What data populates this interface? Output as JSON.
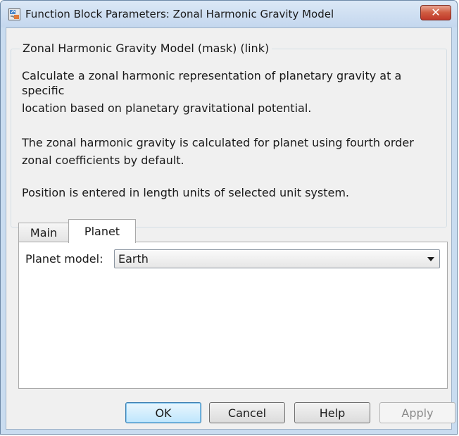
{
  "window": {
    "title": "Function Block Parameters: Zonal Harmonic Gravity Model",
    "close_glyph": "✕",
    "icon": "simulink-block-icon"
  },
  "group": {
    "title": "Zonal Harmonic Gravity Model (mask) (link)",
    "description_lines": [
      "Calculate a zonal harmonic representation of planetary gravity at a",
      "specific",
      "location based on planetary gravitational potential.",
      "The zonal harmonic gravity is calculated for planet using fourth order",
      "zonal coefficients by default.",
      "Position is entered in length units of selected unit system."
    ]
  },
  "tabs": [
    {
      "label": "Main",
      "selected": false
    },
    {
      "label": "Planet",
      "selected": true
    }
  ],
  "planet_tab": {
    "planet_model_label": "Planet model:",
    "planet_model_value": "Earth"
  },
  "buttons": {
    "ok": "OK",
    "cancel": "Cancel",
    "help": "Help",
    "apply": "Apply"
  },
  "colors": {
    "title_bar": "#c4d7ee",
    "close_button": "#c0392b",
    "client_bg": "#f0f0f0",
    "default_button_border": "#3c7fb1"
  }
}
